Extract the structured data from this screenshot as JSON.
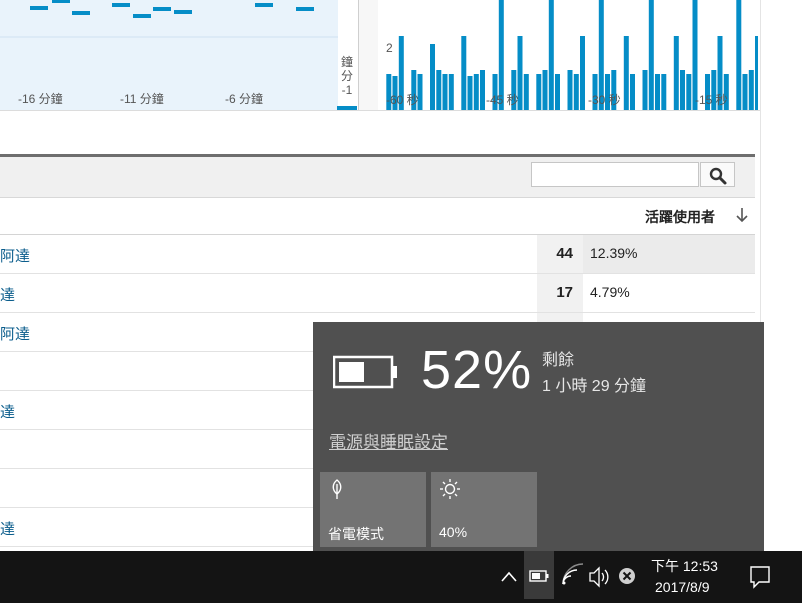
{
  "charts": {
    "left": {
      "ticks": [
        "-16 分鐘",
        "-11 分鐘",
        "-6 分鐘"
      ],
      "separator_label": "鐘 分 -1"
    },
    "right": {
      "y_label": "2",
      "ticks": [
        "-60 秒",
        "-45 秒",
        "-30 秒",
        "-15 秒"
      ]
    }
  },
  "table": {
    "search": {
      "placeholder": ""
    },
    "column_header": "活躍使用者",
    "rows": [
      {
        "name": "阿達",
        "count": "44",
        "percent": "12.39%"
      },
      {
        "name": "達",
        "count": "17",
        "percent": "4.79%"
      },
      {
        "name": "阿達",
        "count": "",
        "percent": ""
      },
      {
        "name": "",
        "count": "",
        "percent": ""
      },
      {
        "name": "達",
        "count": "",
        "percent": ""
      },
      {
        "name": "",
        "count": "",
        "percent": ""
      },
      {
        "name": "",
        "count": "",
        "percent": ""
      },
      {
        "name": "達",
        "count": "",
        "percent": ""
      }
    ]
  },
  "battery": {
    "percent": "52%",
    "remaining_label": "剩餘",
    "remaining_time": "1 小時 29 分鐘",
    "settings_link": "電源與睡眠設定",
    "tiles": [
      {
        "label": "省電模式",
        "icon": "battery-saver-leaf-icon"
      },
      {
        "label": "40%",
        "icon": "brightness-sun-icon"
      }
    ],
    "level_fraction": 0.52
  },
  "taskbar": {
    "time": "下午 12:53",
    "date": "2017/8/9",
    "icons": [
      "chevron-up-icon",
      "battery-icon",
      "wifi-icon",
      "volume-icon",
      "close-circle-icon",
      "notification-icon"
    ]
  },
  "colors": {
    "chart_bar": "#058dc7",
    "flyout_bg": "#505050",
    "tile_bg": "#737373",
    "taskbar_bg": "#141414",
    "link_blue": "#0b5d8c"
  }
}
